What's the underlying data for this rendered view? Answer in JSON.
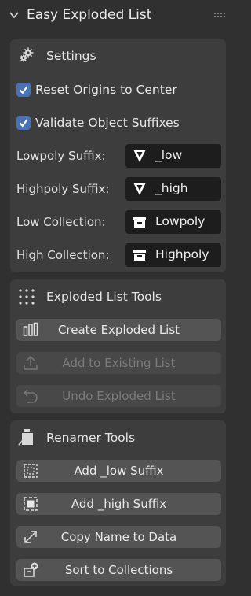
{
  "panel": {
    "title": "Easy Exploded List"
  },
  "settings": {
    "title": "Settings",
    "reset_origins": {
      "label": "Reset Origins to Center",
      "checked": true
    },
    "validate_suffixes": {
      "label": "Validate Object Suffixes",
      "checked": true
    },
    "lowpoly_suffix": {
      "label": "Lowpoly Suffix:",
      "value": "_low"
    },
    "highpoly_suffix": {
      "label": "Highpoly Suffix:",
      "value": "_high"
    },
    "low_collection": {
      "label": "Low Collection:",
      "value": "Lowpoly"
    },
    "high_collection": {
      "label": "High Collection:",
      "value": "Highpoly"
    }
  },
  "exploded_tools": {
    "title": "Exploded List Tools",
    "create": "Create Exploded List",
    "add_existing": "Add to Existing List",
    "undo": "Undo Exploded List"
  },
  "renamer_tools": {
    "title": "Renamer Tools",
    "add_low": "Add _low Suffix",
    "add_high": "Add _high Suffix",
    "copy_name": "Copy Name to Data",
    "sort": "Sort to Collections"
  },
  "colors": {
    "accent": "#4772b3",
    "field_bg": "#1d1d1d",
    "button_bg": "#545454"
  }
}
